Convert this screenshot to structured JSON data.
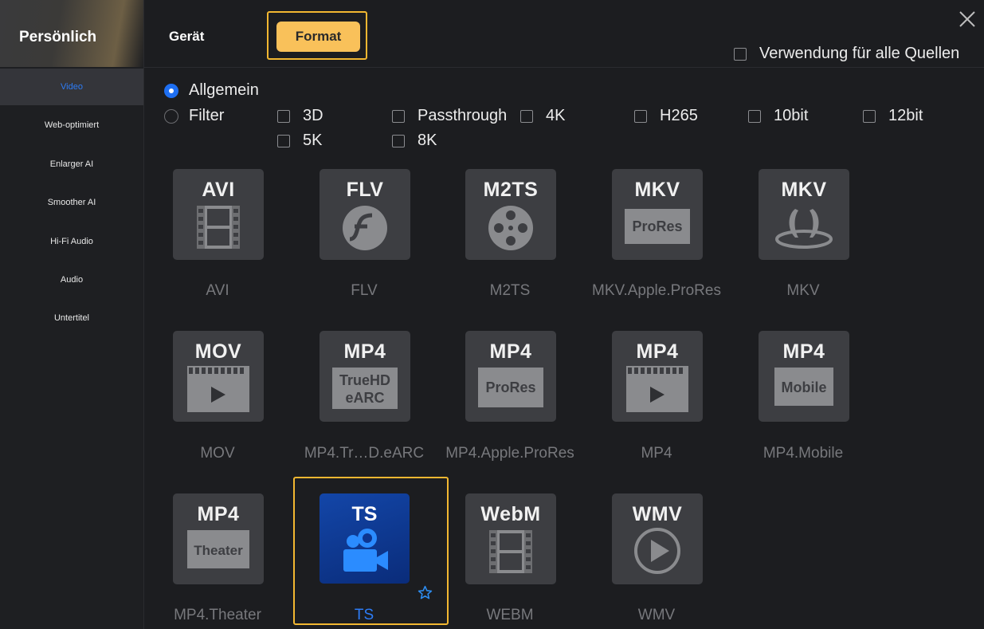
{
  "sidebar": {
    "title": "Persönlich",
    "items": [
      {
        "label": "Video",
        "active": true
      },
      {
        "label": "Web-optimiert"
      },
      {
        "label": "Enlarger AI"
      },
      {
        "label": "Smoother AI"
      },
      {
        "label": "Hi-Fi Audio"
      },
      {
        "label": "Audio"
      },
      {
        "label": "Untertitel"
      }
    ]
  },
  "tabs": {
    "geraet": "Gerät",
    "format": "Format",
    "active": "Format"
  },
  "apply_all": {
    "label": "Verwendung für alle Quellen",
    "checked": false
  },
  "radios": {
    "general": {
      "label": "Allgemein",
      "selected": true
    },
    "filter": {
      "label": "Filter",
      "selected": false
    }
  },
  "filters": [
    "3D",
    "Passthrough",
    "4K",
    "H265",
    "10bit",
    "12bit",
    "5K",
    "8K"
  ],
  "formats": [
    {
      "code": "AVI",
      "sub": "",
      "caption": "AVI"
    },
    {
      "code": "FLV",
      "sub": "",
      "caption": "FLV"
    },
    {
      "code": "M2TS",
      "sub": "",
      "caption": "M2TS"
    },
    {
      "code": "MKV",
      "sub": "ProRes",
      "caption": "MKV.Apple.ProRes"
    },
    {
      "code": "MKV",
      "sub": "",
      "caption": "MKV"
    },
    {
      "code": "MOV",
      "sub": "",
      "caption": "MOV"
    },
    {
      "code": "MP4",
      "sub": "TrueHD",
      "sub2": "eARC",
      "caption": "MP4.Tr…D.eARC"
    },
    {
      "code": "MP4",
      "sub": "ProRes",
      "caption": "MP4.Apple.ProRes"
    },
    {
      "code": "MP4",
      "sub": "",
      "caption": "MP4"
    },
    {
      "code": "MP4",
      "sub": "Mobile",
      "caption": "MP4.Mobile"
    },
    {
      "code": "MP4",
      "sub": "Theater",
      "caption": "MP4.Theater"
    },
    {
      "code": "TS",
      "sub": "",
      "caption": "TS",
      "selected": true
    },
    {
      "code": "WebM",
      "sub": "",
      "caption": "WEBM"
    },
    {
      "code": "WMV",
      "sub": "",
      "caption": "WMV"
    }
  ],
  "colors": {
    "accent": "#f2b731",
    "selected_text": "#2d7cf6",
    "tile": "#3d3e42"
  }
}
